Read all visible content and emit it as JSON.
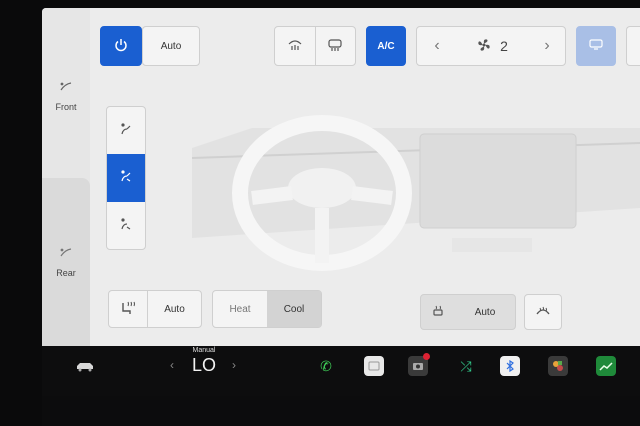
{
  "climate": {
    "power_icon": "power-icon",
    "auto_label": "Auto",
    "front_label": "Front",
    "rear_label": "Rear",
    "ac_label": "A/C",
    "fan_speed": "2",
    "fan_prev": "‹",
    "fan_next": "›"
  },
  "seat": {
    "auto_label": "Auto",
    "heat_label": "Heat",
    "cool_label": "Cool",
    "right_auto_label": "Auto"
  },
  "taskbar": {
    "temp_mode_label": "Manual",
    "temp_value": "LO",
    "temp_prev": "‹",
    "temp_next": "›"
  },
  "colors": {
    "accent": "#1a5fd1",
    "pale_accent": "#a9bfe6"
  }
}
